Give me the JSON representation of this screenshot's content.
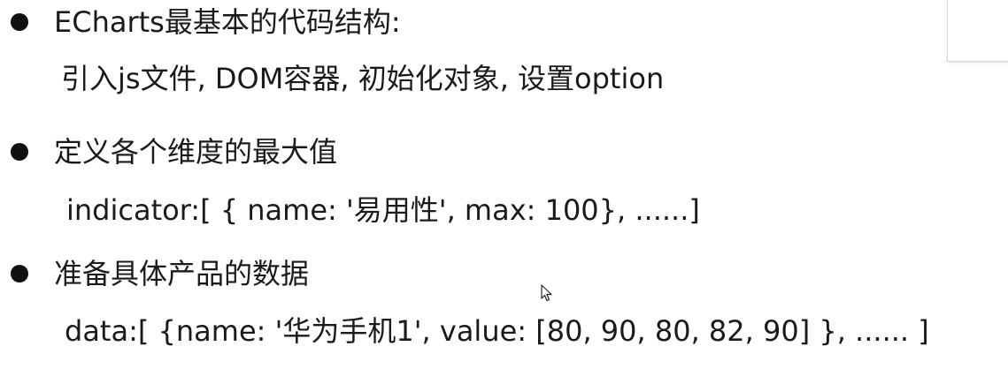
{
  "bullets": [
    {
      "heading": "ECharts最基本的代码结构:",
      "detail": "引入js文件, DOM容器, 初始化对象, 设置option"
    },
    {
      "heading": "定义各个维度的最大值",
      "detail": "indicator:[ { name: '易用性', max: 100}, ......]"
    },
    {
      "heading": "准备具体产品的数据",
      "detail": "data:[ {name: '华为手机1', value: [80, 90, 80, 82, 90] }, ......  ]"
    }
  ],
  "icons": {
    "bullet": "filled-circle-bullet",
    "cursor": "mouse-pointer-icon"
  },
  "colors": {
    "text": "#1a1a1a",
    "background": "#ffffff"
  }
}
